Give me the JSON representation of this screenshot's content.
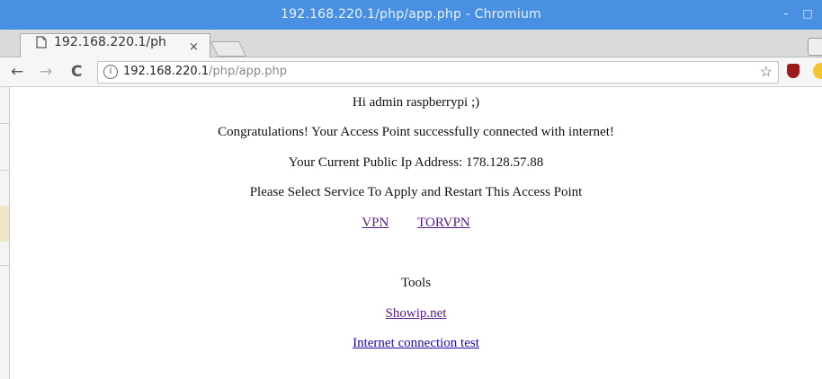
{
  "window": {
    "title": "192.168.220.1/php/app.php - Chromium"
  },
  "tab": {
    "title": "192.168.220.1/ph",
    "close": "×"
  },
  "omnibox": {
    "host": "192.168.220.1",
    "path": "/php/app.php"
  },
  "page": {
    "greeting": "Hi admin raspberrypi ;)",
    "congrats": "Congratulations! Your Access Point successfully connected with internet!",
    "public_ip": "Your Current Public Ip Address: 178.128.57.88",
    "select_service": "Please Select Service To Apply and Restart This Access Point",
    "services": [
      "VPN",
      "TORVPN"
    ],
    "tools_heading": "Tools",
    "tools": [
      "Showip.net",
      "Internet connection test"
    ]
  },
  "icons": {
    "back": "arrow-left-icon",
    "forward": "arrow-right-icon",
    "reload": "reload-icon",
    "info": "info-icon",
    "bookmark": "star-icon",
    "ublock": "ublock-extension-icon",
    "extension2": "yellow-extension-icon"
  },
  "colors": {
    "titlebar": "#4a90e2",
    "visited_link": "#551a8b",
    "link": "#1a0dab"
  }
}
